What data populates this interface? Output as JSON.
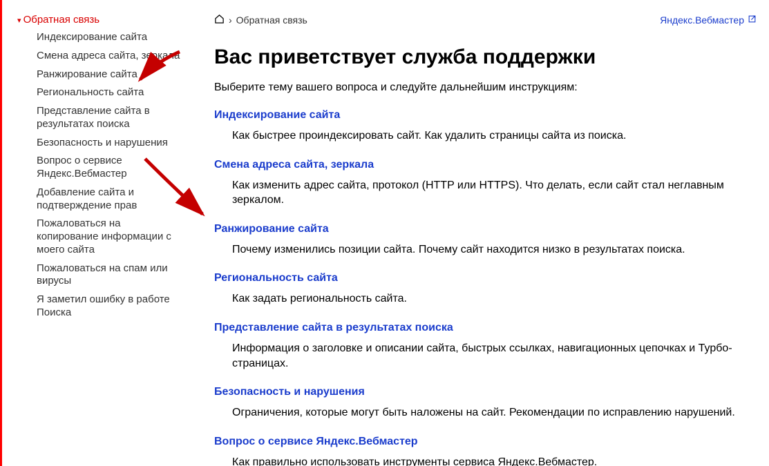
{
  "sidebar": {
    "root_label": "Обратная связь",
    "items": [
      "Индексирование сайта",
      "Смена адреса сайта, зеркала",
      "Ранжирование сайта",
      "Региональность сайта",
      "Представление сайта в результатах поиска",
      "Безопасность и нарушения",
      "Вопрос о сервисе Яндекс.Вебмастер",
      "Добавление сайта и подтверждение прав",
      "Пожаловаться на копирование информации с моего сайта",
      "Пожаловаться на спам или вирусы",
      "Я заметил ошибку в работе Поиска"
    ]
  },
  "breadcrumb": {
    "current": "Обратная связь"
  },
  "external_link": {
    "label": "Яндекс.Вебмастер"
  },
  "heading": "Вас приветствует служба поддержки",
  "intro": "Выберите тему вашего вопроса и следуйте дальнейшим инструкциям:",
  "topics": [
    {
      "title": "Индексирование сайта",
      "desc": "Как быстрее проиндексировать сайт. Как удалить страницы сайта из поиска."
    },
    {
      "title": "Смена адреса сайта, зеркала",
      "desc": "Как изменить адрес сайта, протокол (HTTP или HTTPS). Что делать, если сайт стал неглавным зеркалом."
    },
    {
      "title": "Ранжирование сайта",
      "desc": "Почему изменились позиции сайта. Почему сайт находится низко в результатах поиска."
    },
    {
      "title": "Региональность сайта",
      "desc": "Как задать региональность сайта."
    },
    {
      "title": "Представление сайта в результатах поиска",
      "desc": "Информация о заголовке и описании сайта, быстрых ссылках, навигационных цепочках и Турбо-страницах."
    },
    {
      "title": "Безопасность и нарушения",
      "desc": "Ограничения, которые могут быть наложены на сайт. Рекомендации по исправлению нарушений."
    },
    {
      "title": "Вопрос о сервисе Яндекс.Вебмастер",
      "desc": "Как правильно использовать инструменты сервиса Яндекс.Вебмастер."
    }
  ]
}
